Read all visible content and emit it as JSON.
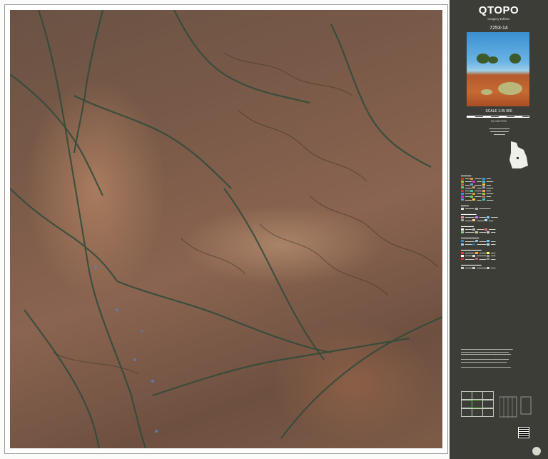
{
  "panel": {
    "title": "QTOPO",
    "edition": "Imagery Edition",
    "sheet_number": "7253-14",
    "scale": "SCALE 1:25 000",
    "km_label": "KILOMETRES"
  },
  "colors": {
    "panel_bg": "#3b3d36",
    "map_terrain": "#7a5a48",
    "watercourse": "#2f4a3a",
    "frame": "#ffffff"
  },
  "icons": [
    "queensland-outline-icon",
    "qr-code-icon",
    "government-crest-icon"
  ]
}
